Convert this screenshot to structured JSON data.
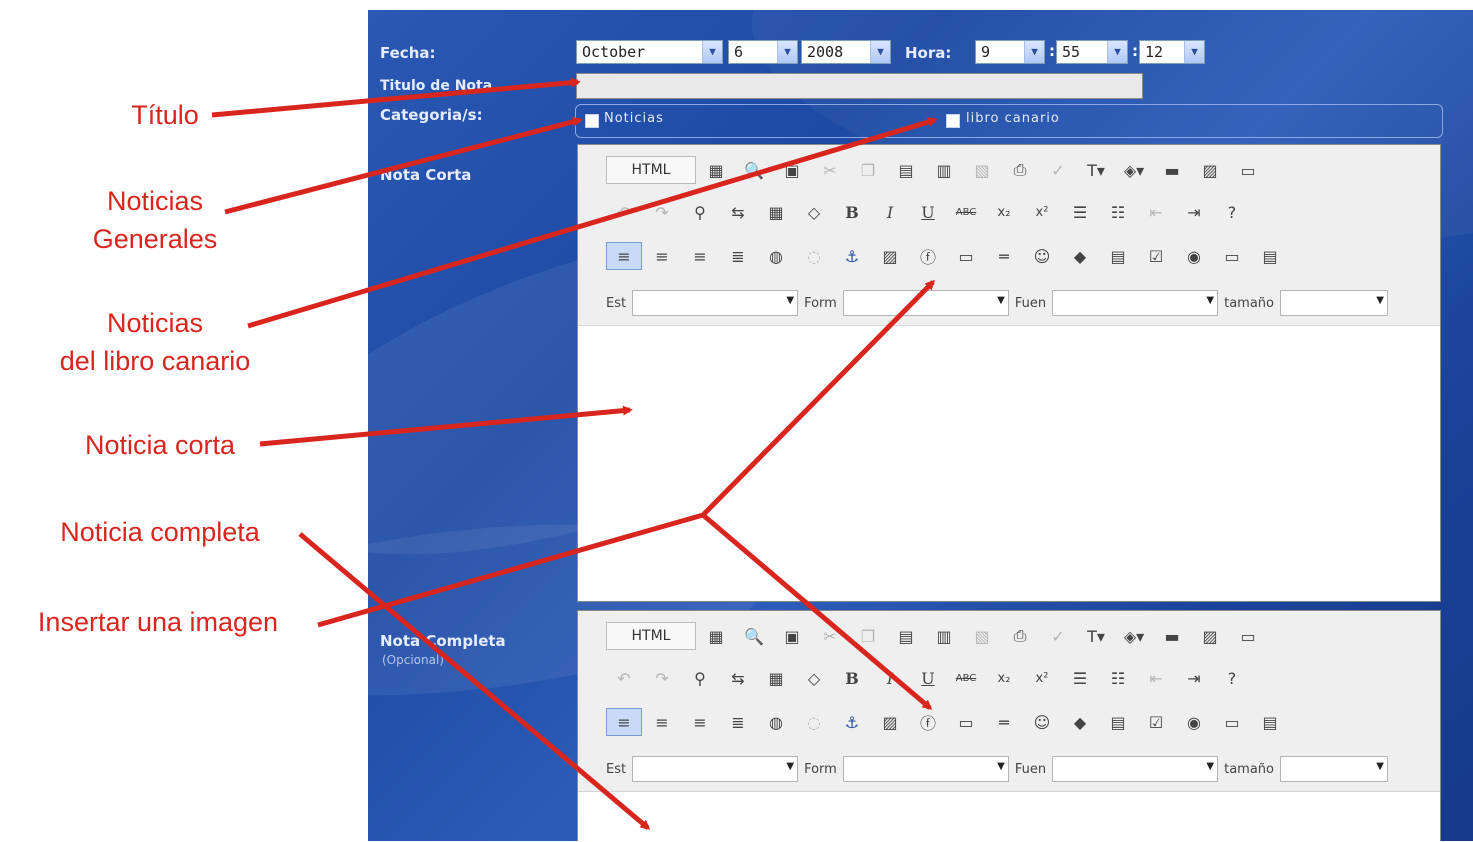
{
  "form": {
    "fecha_label": "Fecha:",
    "month": "October",
    "day": "6",
    "year": "2008",
    "hora_label": "Hora:",
    "hour": "9",
    "minute": "55",
    "second": "12",
    "titulo_label": "Titulo de Nota",
    "categorias_label": "Categoria/s:",
    "categories": [
      "Noticias",
      "libro canario"
    ],
    "nota_corta_label": "Nota Corta",
    "nota_completa_label": "Nota Completa",
    "opcional_label": "(Opcional)"
  },
  "editor_toolbar": {
    "html_label": "HTML",
    "style_label": "Est",
    "format_label": "Form",
    "font_label": "Fuen",
    "size_label": "tamaño"
  },
  "annotations": {
    "titulo": "Título",
    "noticias_generales": [
      "Noticias",
      "Generales"
    ],
    "noticias_libro": [
      "Noticias",
      "del libro canario"
    ],
    "noticia_corta": "Noticia corta",
    "noticia_completa": "Noticia completa",
    "insertar_imagen": "Insertar una imagen"
  },
  "colors": {
    "panel": "#1d4aa4",
    "annotation": "#d8261e"
  }
}
